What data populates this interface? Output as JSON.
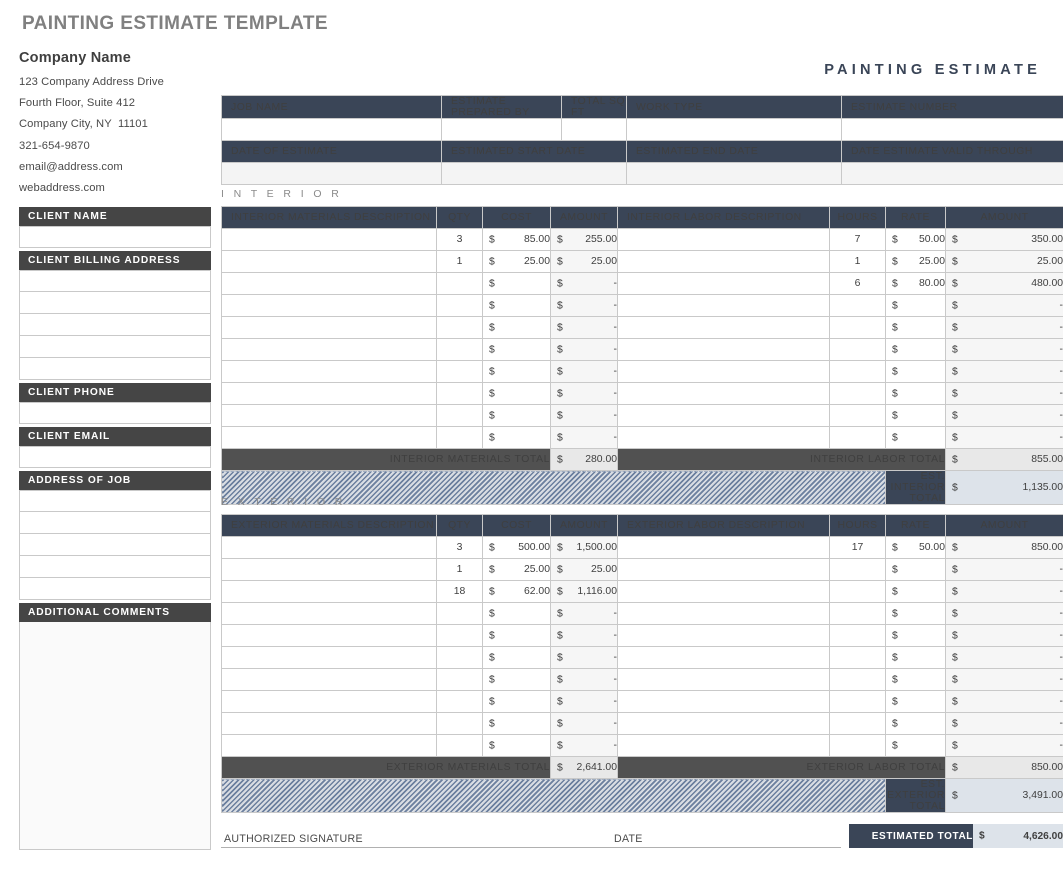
{
  "doc": {
    "title": "PAINTING ESTIMATE TEMPLATE",
    "estimate_heading": "PAINTING ESTIMATE"
  },
  "company": {
    "name": "Company Name",
    "lines": [
      "123 Company Address Drive",
      "Fourth Floor, Suite 412",
      "Company City, NY  11101",
      "321-654-9870",
      "email@address.com",
      "webaddress.com"
    ]
  },
  "client_blocks": [
    {
      "label": "CLIENT NAME",
      "rows": 1
    },
    {
      "label": "CLIENT BILLING ADDRESS",
      "rows": 5
    },
    {
      "label": "CLIENT PHONE",
      "rows": 1
    },
    {
      "label": "CLIENT EMAIL",
      "rows": 1
    },
    {
      "label": "ADDRESS OF JOB",
      "rows": 5
    },
    {
      "label": "ADDITIONAL COMMENTS",
      "rows": 0
    }
  ],
  "job_info": {
    "row1_headers": [
      "JOB NAME",
      "ESTIMATE PREPARED BY",
      "TOTAL SQ FT",
      "WORK TYPE",
      "ESTIMATE NUMBER"
    ],
    "row1_values": [
      "",
      "",
      "",
      "",
      ""
    ],
    "row2_headers": [
      "DATE OF ESTIMATE",
      "ESTIMATED START DATE",
      "ESTIMATED END DATE",
      "DATE ESTIMATE VALID THROUGH"
    ],
    "row2_values": [
      "",
      "",
      "",
      ""
    ]
  },
  "sections": [
    {
      "label": "I N T E R I O R",
      "materials_header": "INTERIOR MATERIALS DESCRIPTION",
      "labor_header": "INTERIOR LABOR DESCRIPTION",
      "col_qty": "QTY",
      "col_cost": "COST",
      "col_amount": "AMOUNT",
      "col_hours": "HOURS",
      "col_rate": "RATE",
      "col_amount2": "AMOUNT",
      "rows": [
        {
          "desc": "",
          "qty": "3",
          "cost": "85.00",
          "amount": "255.00",
          "labor_desc": "",
          "hours": "7",
          "rate": "50.00",
          "labor_amount": "350.00"
        },
        {
          "desc": "",
          "qty": "1",
          "cost": "25.00",
          "amount": "25.00",
          "labor_desc": "",
          "hours": "1",
          "rate": "25.00",
          "labor_amount": "25.00"
        },
        {
          "desc": "",
          "qty": "",
          "cost": "",
          "amount": "-",
          "labor_desc": "",
          "hours": "6",
          "rate": "80.00",
          "labor_amount": "480.00"
        },
        {
          "desc": "",
          "qty": "",
          "cost": "",
          "amount": "-",
          "labor_desc": "",
          "hours": "",
          "rate": "",
          "labor_amount": "-"
        },
        {
          "desc": "",
          "qty": "",
          "cost": "",
          "amount": "-",
          "labor_desc": "",
          "hours": "",
          "rate": "",
          "labor_amount": "-"
        },
        {
          "desc": "",
          "qty": "",
          "cost": "",
          "amount": "-",
          "labor_desc": "",
          "hours": "",
          "rate": "",
          "labor_amount": "-"
        },
        {
          "desc": "",
          "qty": "",
          "cost": "",
          "amount": "-",
          "labor_desc": "",
          "hours": "",
          "rate": "",
          "labor_amount": "-"
        },
        {
          "desc": "",
          "qty": "",
          "cost": "",
          "amount": "-",
          "labor_desc": "",
          "hours": "",
          "rate": "",
          "labor_amount": "-"
        },
        {
          "desc": "",
          "qty": "",
          "cost": "",
          "amount": "-",
          "labor_desc": "",
          "hours": "",
          "rate": "",
          "labor_amount": "-"
        },
        {
          "desc": "",
          "qty": "",
          "cost": "",
          "amount": "-",
          "labor_desc": "",
          "hours": "",
          "rate": "",
          "labor_amount": "-"
        }
      ],
      "materials_total_label": "INTERIOR MATERIALS TOTAL",
      "materials_total_value": "280.00",
      "labor_total_label": "INTERIOR LABOR TOTAL",
      "labor_total_value": "855.00",
      "est_total_label": "EST. INTERIOR  TOTAL",
      "est_total_value": "1,135.00"
    },
    {
      "label": "E X T E R I O R",
      "materials_header": "EXTERIOR MATERIALS DESCRIPTION",
      "labor_header": "EXTERIOR LABOR DESCRIPTION",
      "col_qty": "QTY",
      "col_cost": "COST",
      "col_amount": "AMOUNT",
      "col_hours": "HOURS",
      "col_rate": "RATE",
      "col_amount2": "AMOUNT",
      "rows": [
        {
          "desc": "",
          "qty": "3",
          "cost": "500.00",
          "amount": "1,500.00",
          "labor_desc": "",
          "hours": "17",
          "rate": "50.00",
          "labor_amount": "850.00"
        },
        {
          "desc": "",
          "qty": "1",
          "cost": "25.00",
          "amount": "25.00",
          "labor_desc": "",
          "hours": "",
          "rate": "",
          "labor_amount": "-"
        },
        {
          "desc": "",
          "qty": "18",
          "cost": "62.00",
          "amount": "1,116.00",
          "labor_desc": "",
          "hours": "",
          "rate": "",
          "labor_amount": "-"
        },
        {
          "desc": "",
          "qty": "",
          "cost": "",
          "amount": "-",
          "labor_desc": "",
          "hours": "",
          "rate": "",
          "labor_amount": "-"
        },
        {
          "desc": "",
          "qty": "",
          "cost": "",
          "amount": "-",
          "labor_desc": "",
          "hours": "",
          "rate": "",
          "labor_amount": "-"
        },
        {
          "desc": "",
          "qty": "",
          "cost": "",
          "amount": "-",
          "labor_desc": "",
          "hours": "",
          "rate": "",
          "labor_amount": "-"
        },
        {
          "desc": "",
          "qty": "",
          "cost": "",
          "amount": "-",
          "labor_desc": "",
          "hours": "",
          "rate": "",
          "labor_amount": "-"
        },
        {
          "desc": "",
          "qty": "",
          "cost": "",
          "amount": "-",
          "labor_desc": "",
          "hours": "",
          "rate": "",
          "labor_amount": "-"
        },
        {
          "desc": "",
          "qty": "",
          "cost": "",
          "amount": "-",
          "labor_desc": "",
          "hours": "",
          "rate": "",
          "labor_amount": "-"
        },
        {
          "desc": "",
          "qty": "",
          "cost": "",
          "amount": "-",
          "labor_desc": "",
          "hours": "",
          "rate": "",
          "labor_amount": "-"
        }
      ],
      "materials_total_label": "EXTERIOR MATERIALS TOTAL",
      "materials_total_value": "2,641.00",
      "labor_total_label": "EXTERIOR LABOR TOTAL",
      "labor_total_value": "850.00",
      "est_total_label": "EST. EXTERIOR  TOTAL",
      "est_total_value": "3,491.00"
    }
  ],
  "footer": {
    "signature_label": "AUTHORIZED SIGNATURE",
    "date_label": "DATE",
    "grand_total_label": "ESTIMATED TOTAL",
    "grand_total_value": "4,626.00",
    "currency": "$"
  },
  "colors": {
    "navy": "#3a4557",
    "dark_gray": "#515151",
    "block_head": "#454545",
    "title_gray": "#808080",
    "est_value_bg": "#dde3ea"
  }
}
